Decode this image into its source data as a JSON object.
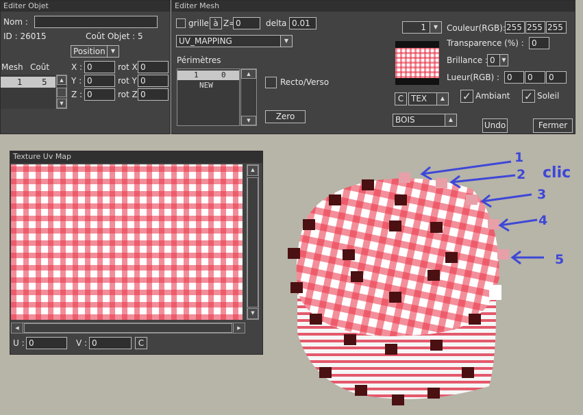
{
  "objet": {
    "title": "Editer Objet",
    "nom_label": "Nom :",
    "nom_value": "",
    "id_text": "ID : 26015",
    "cout_text": "Coût Objet : 5",
    "mode": "Position",
    "mesh_label": "Mesh",
    "cout_label": "Coût",
    "mesh_row": {
      "mesh": "1",
      "cout": "5"
    },
    "coords": [
      {
        "label": "X :",
        "value": "0",
        "rot_label": "rot X",
        "rot_value": "0"
      },
      {
        "label": "Y :",
        "value": "0",
        "rot_label": "rot Y",
        "rot_value": "0"
      },
      {
        "label": "Z :",
        "value": "0",
        "rot_label": "rot Z",
        "rot_value": "0"
      }
    ]
  },
  "mesh": {
    "title": "Editer Mesh",
    "grille_label": "grille",
    "a_label": "à",
    "z_label": "Z=",
    "z_value": "0",
    "delta_label": "delta",
    "delta_value": "0.01",
    "mapping": "UV_MAPPING",
    "perimetres_label": "Périmètres",
    "perimetres": [
      {
        "col1": "1",
        "col2": "0"
      },
      {
        "col1": "NEW",
        "col2": ""
      }
    ],
    "recto_label": "Recto/Verso",
    "zero_button": "Zero",
    "index_select": "1",
    "couleur_label": "Couleur(RGB):",
    "couleur": [
      "255",
      "255",
      "255"
    ],
    "transparence_label": "Transparence (%) :",
    "transparence": "0",
    "brillance_label": "Brillance :",
    "brillance": "0",
    "lueur_label": "Lueur(RGB) :",
    "lueur": [
      "0",
      "0",
      "0"
    ],
    "c_button": "C",
    "tex_select": "TEX",
    "ambiant_label": "Ambiant",
    "soleil_label": "Soleil",
    "material": "BOIS",
    "undo_button": "Undo",
    "fermer_button": "Fermer"
  },
  "uvmap": {
    "title": "Texture Uv Map",
    "u_label": "U :",
    "u_value": "0",
    "v_label": "V :",
    "v_value": "0",
    "c_button": "C"
  },
  "annotations": {
    "n1": "1",
    "n2": "2",
    "n3": "3",
    "n4": "4",
    "n5": "5",
    "clic": "clic",
    "color": "#3d47d8"
  },
  "colors": {
    "panel": "#424242",
    "background": "#b7b4a8",
    "gingham_red": "#e83246"
  }
}
